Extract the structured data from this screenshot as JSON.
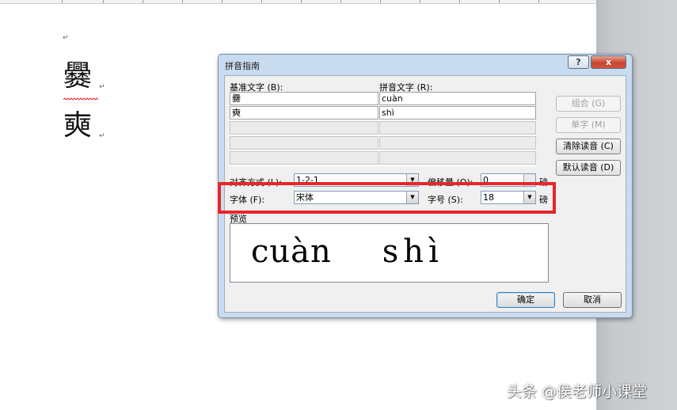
{
  "document": {
    "para_mark": "↵",
    "chars": [
      "爨",
      "奭"
    ]
  },
  "dialog": {
    "title": "拼音指南",
    "help_label": "?",
    "close_label": "x",
    "base_text_label": "基准文字 (B):",
    "pinyin_text_label": "拼音文字 (R):",
    "rows": [
      {
        "base": "爨",
        "pinyin": "cuàn"
      },
      {
        "base": "奭",
        "pinyin": "shì"
      },
      {
        "base": "",
        "pinyin": ""
      },
      {
        "base": "",
        "pinyin": ""
      },
      {
        "base": "",
        "pinyin": ""
      }
    ],
    "side_buttons": [
      {
        "label": "组合 (G)",
        "enabled": false
      },
      {
        "label": "单字 (M)",
        "enabled": false
      },
      {
        "label": "清除读音 (C)",
        "enabled": true
      },
      {
        "label": "默认读音 (D)",
        "enabled": true
      }
    ],
    "alignment_label": "对齐方式 (L):",
    "alignment_value": "1-2-1",
    "offset_label": "偏移量 (O):",
    "offset_value": "0",
    "offset_unit": "磅",
    "font_label": "字体 (F):",
    "font_value": "宋体",
    "size_label": "字号 (S):",
    "size_value": "18",
    "size_unit": "磅",
    "preview_label": "预览",
    "preview_text": [
      "cuàn",
      "shì"
    ],
    "ok_label": "确定",
    "cancel_label": "取消"
  },
  "highlight_color": "#e8262a",
  "watermark": "头条 @侯老师小课堂"
}
